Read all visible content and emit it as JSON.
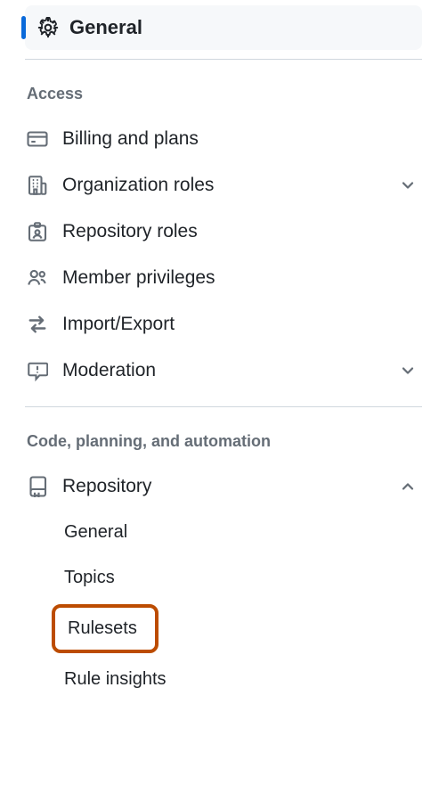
{
  "active": {
    "label": "General"
  },
  "sections": {
    "access": {
      "title": "Access",
      "billing": "Billing and plans",
      "org_roles": "Organization roles",
      "repo_roles": "Repository roles",
      "member_priv": "Member privileges",
      "import_export": "Import/Export",
      "moderation": "Moderation"
    },
    "code": {
      "title": "Code, planning, and automation",
      "repository": "Repository",
      "sub": {
        "general": "General",
        "topics": "Topics",
        "rulesets": "Rulesets",
        "rule_insights": "Rule insights"
      }
    }
  }
}
